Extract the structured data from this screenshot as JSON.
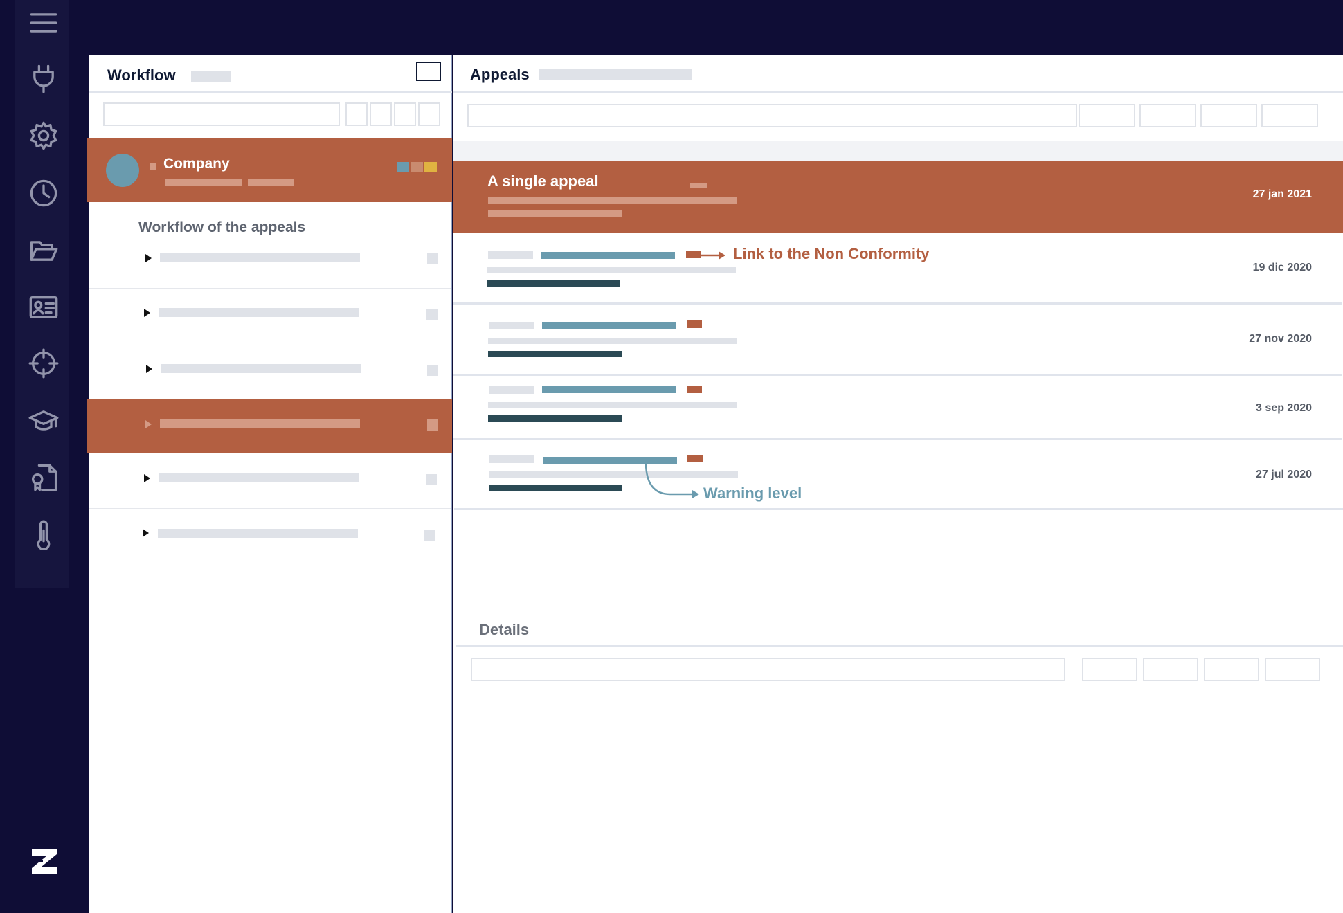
{
  "sidebar": {
    "items": [
      {
        "icon": "menu-icon"
      },
      {
        "icon": "plug-icon"
      },
      {
        "icon": "gear-icon"
      },
      {
        "icon": "clock-icon"
      },
      {
        "icon": "folder-open-icon"
      },
      {
        "icon": "id-card-icon"
      },
      {
        "icon": "crosshair-icon"
      },
      {
        "icon": "graduation-cap-icon"
      },
      {
        "icon": "certificate-document-icon"
      },
      {
        "icon": "thermometer-icon"
      }
    ],
    "logo": "z-logo"
  },
  "workflow": {
    "title": "Workflow",
    "company": {
      "name": "Company",
      "avatar_color": "#6a9bae",
      "tags": [
        "#6a9bae",
        "#c98b6f",
        "#e0b341"
      ]
    },
    "section_title": "Workflow of the appeals",
    "rows": [
      {
        "selected": false
      },
      {
        "selected": false
      },
      {
        "selected": false
      },
      {
        "selected": true
      },
      {
        "selected": false
      },
      {
        "selected": false
      }
    ]
  },
  "appeals": {
    "title": "Appeals",
    "selected": {
      "title": "A single appeal",
      "date": "27 jan 2021"
    },
    "items": [
      {
        "date": "19 dic 2020"
      },
      {
        "date": "27 nov 2020"
      },
      {
        "date": "3 sep 2020"
      },
      {
        "date": "27 jul 2020"
      }
    ],
    "annotations": {
      "link": "Link to the Non Conformity",
      "warning": "Warning level"
    }
  },
  "details": {
    "title": "Details"
  },
  "colors": {
    "background": "#0f0d36",
    "accent": "#b35f41",
    "warning": "#6a9bae"
  }
}
